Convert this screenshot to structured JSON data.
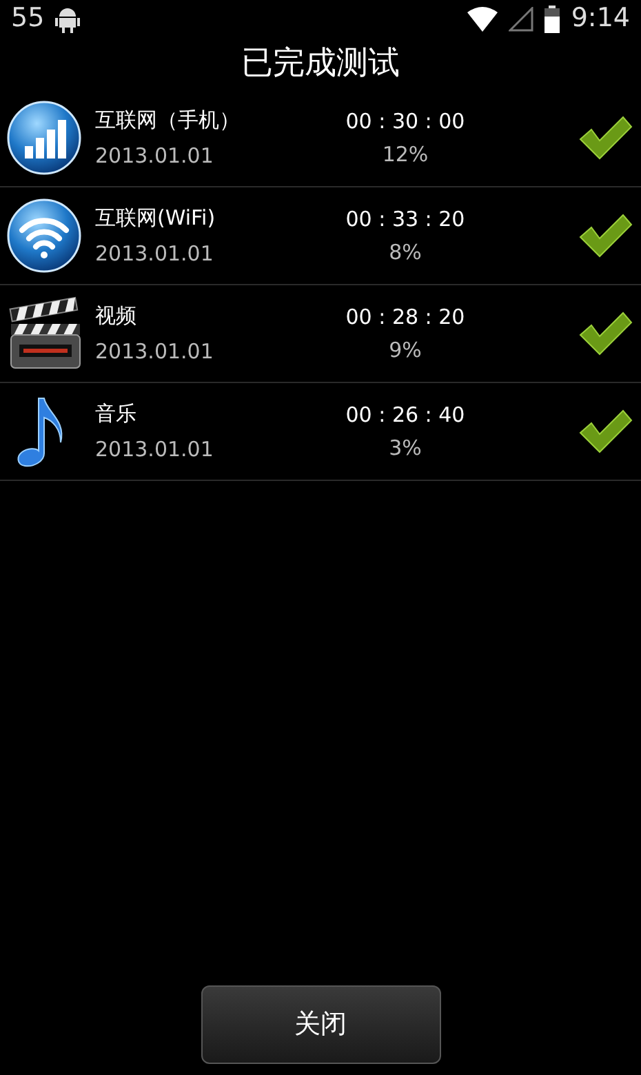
{
  "status_bar": {
    "notification_count": "55",
    "time": "9:14"
  },
  "title": "已完成测试",
  "tests": [
    {
      "kind": "cellular",
      "name": "互联网（手机）",
      "date": "2013.01.01",
      "duration": "00 : 30 : 00",
      "percent": "12%",
      "completed": true
    },
    {
      "kind": "wifi",
      "name": "互联网(WiFi)",
      "date": "2013.01.01",
      "duration": "00 : 33 : 20",
      "percent": "8%",
      "completed": true
    },
    {
      "kind": "video",
      "name": "视频",
      "date": "2013.01.01",
      "duration": "00 : 28 : 20",
      "percent": "9%",
      "completed": true
    },
    {
      "kind": "music",
      "name": "音乐",
      "date": "2013.01.01",
      "duration": "00 : 26 : 40",
      "percent": "3%",
      "completed": true
    }
  ],
  "close_button": "关闭"
}
